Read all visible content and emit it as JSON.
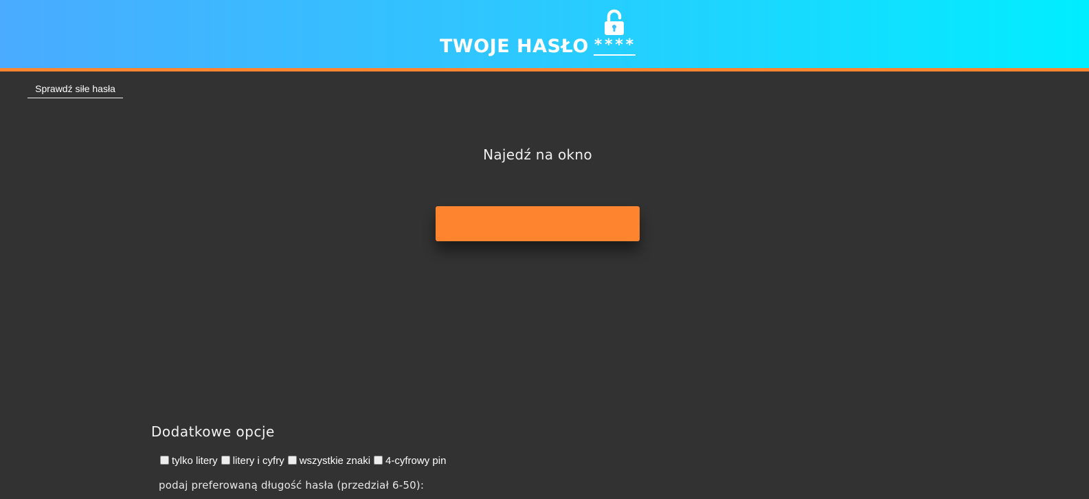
{
  "header": {
    "title": "TWOJE HASŁO",
    "masked": "****",
    "icon": "unlocked-padlock-icon",
    "colors": {
      "gradient_start": "#4aabff",
      "gradient_end": "#00eeff",
      "accent_border": "#ff8530"
    }
  },
  "nav": {
    "check_strength_link": "Sprawdź siłe hasła"
  },
  "main": {
    "hover_prompt": "Najedź na okno",
    "password_box_color": "#ff8430"
  },
  "options": {
    "title": "Dodatkowe opcje",
    "checkboxes": [
      {
        "label": "tylko litery",
        "checked": false
      },
      {
        "label": "litery i cyfry",
        "checked": false
      },
      {
        "label": "wszystkie znaki",
        "checked": false
      },
      {
        "label": "4-cyfrowy pin",
        "checked": false
      }
    ],
    "length_label": "podaj preferowaną długość hasła (przedział 6-50):"
  },
  "colors": {
    "background": "#323232"
  }
}
